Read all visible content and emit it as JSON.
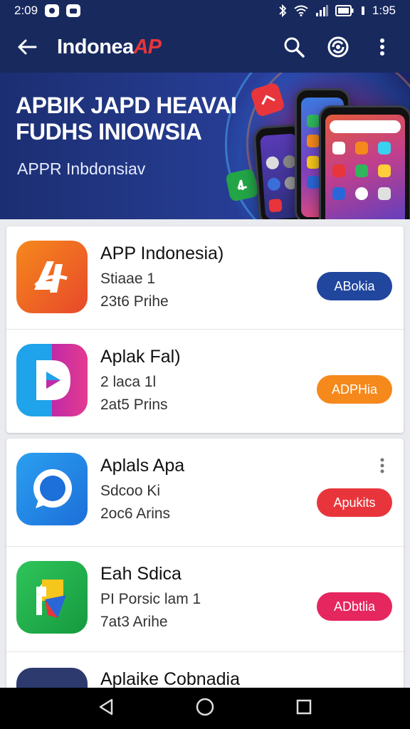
{
  "status_bar": {
    "time_left": "2:09",
    "time_right": "1:95",
    "icons": [
      "notification-icon",
      "message-icon",
      "bluetooth-icon",
      "wifi-icon",
      "signal-icon",
      "battery-icon"
    ]
  },
  "app_bar": {
    "title_main": "Indonea",
    "title_accent": "AP",
    "icons": [
      "back-arrow-icon",
      "search-icon",
      "refresh-icon",
      "more-vert-icon"
    ]
  },
  "banner": {
    "headline_line1": "APBIK JAPD HEAVAI",
    "headline_line2": "FUDHS INIOWSIA",
    "subtitle": "APPR Inbdonsiav"
  },
  "apps": [
    {
      "name": "APP Indonesia)",
      "line1": "Stiaae 1",
      "line2": "23t6 Prihe",
      "button": "ABokia",
      "button_color": "#20469e",
      "icon": "app-a-icon"
    },
    {
      "name": "Aplak Fal)",
      "line1": "2 laca 1l",
      "line2": "2at5 Prins",
      "button": "ADPHia",
      "button_color": "#f5891c",
      "icon": "play-icon"
    },
    {
      "name": "Aplals Apa",
      "line1": "Sdcoo Ki",
      "line2": "2oc6 Arins",
      "button": "Apukits",
      "button_color": "#e8353b",
      "icon": "chat-bubble-icon"
    },
    {
      "name": "Eah Sdica",
      "line1": "PI Porsic lam 1",
      "line2": "7at3 Arihe",
      "button": "ADbtlia",
      "button_color": "#e5265f",
      "icon": "maps-icon"
    },
    {
      "name": "Aplaike Cobnadia",
      "icon": "partial-app-icon"
    }
  ],
  "colors": {
    "primary": "#18295e",
    "accent_red": "#e8353b"
  }
}
